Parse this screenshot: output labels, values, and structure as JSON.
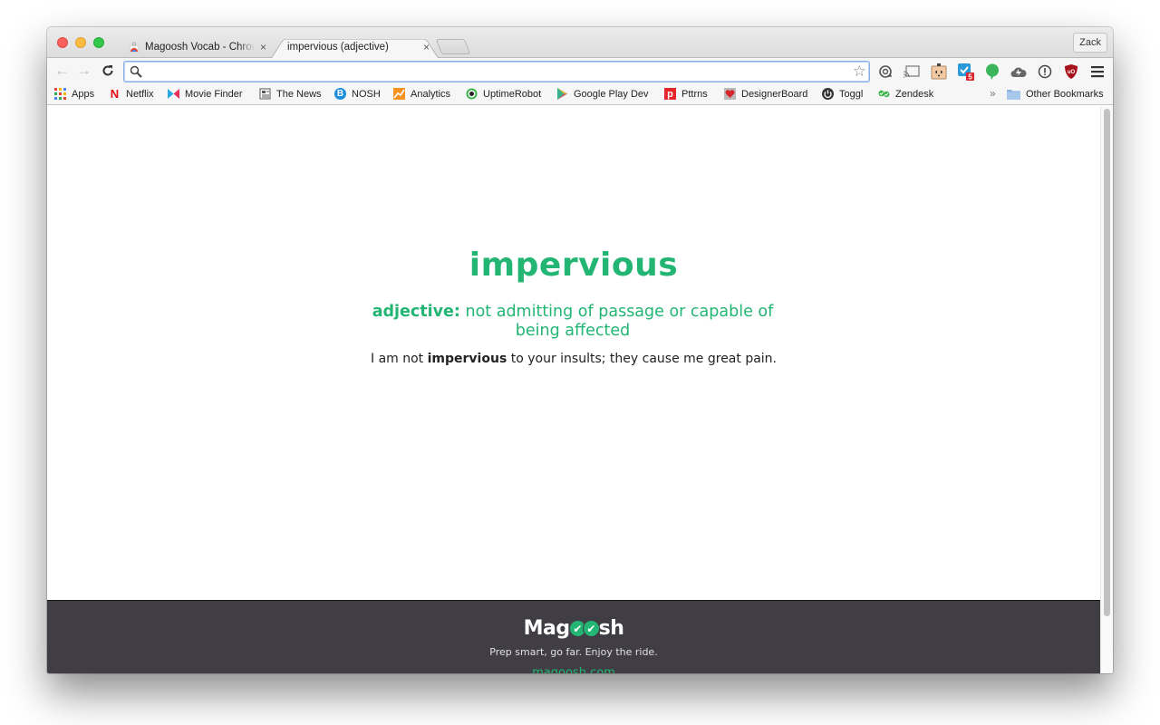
{
  "browser": {
    "tabs": [
      {
        "title": "Magoosh Vocab - Chrome Web Store",
        "active": false
      },
      {
        "title": "impervious (adjective)",
        "active": true
      }
    ],
    "close_glyph": "×",
    "profile_name": "Zack",
    "omnibox": {
      "value": "",
      "placeholder": ""
    },
    "nav": {
      "back": "←",
      "forward": "→",
      "reload": "C"
    },
    "extensions": [
      {
        "name": "sync-icon"
      },
      {
        "name": "cast-icon"
      },
      {
        "name": "outlet-icon"
      },
      {
        "name": "checkbox-extension-icon",
        "badge": "5"
      },
      {
        "name": "green-chat-bubble-icon"
      },
      {
        "name": "cloud-upload-icon"
      },
      {
        "name": "info-icon"
      },
      {
        "name": "ublock-icon"
      },
      {
        "name": "menu-icon"
      }
    ],
    "bookmarks": [
      {
        "label": "Apps",
        "icon": "apps-grid-icon"
      },
      {
        "label": "Netflix",
        "icon": "netflix-icon"
      },
      {
        "label": "Movie Finder",
        "icon": "movie-finder-icon"
      },
      {
        "label": "The News",
        "icon": "newspaper-icon"
      },
      {
        "label": "NOSH",
        "icon": "nosh-icon"
      },
      {
        "label": "Analytics",
        "icon": "analytics-icon"
      },
      {
        "label": "UptimeRobot",
        "icon": "uptimerobot-icon"
      },
      {
        "label": "Google Play Dev",
        "icon": "google-play-icon"
      },
      {
        "label": "Pttrns",
        "icon": "pttrns-icon"
      },
      {
        "label": "DesignerBoard",
        "icon": "designerboard-icon"
      },
      {
        "label": "Toggl",
        "icon": "toggl-icon"
      },
      {
        "label": "Zendesk",
        "icon": "zendesk-icon"
      }
    ],
    "bookmarks_overflow": "»",
    "other_bookmarks": "Other Bookmarks"
  },
  "page": {
    "word": "impervious",
    "part_of_speech": "adjective:",
    "definition": "not admitting of passage or capable of being affected",
    "example_before": "I am not ",
    "example_word": "impervious",
    "example_after": " to your insults; they cause me great pain.",
    "accent_color": "#22b573"
  },
  "footer": {
    "logo_prefix": "Mag",
    "logo_suffix": "sh",
    "tagline": "Prep smart, go far. Enjoy the ride.",
    "site": "magoosh.com",
    "background_color": "#403e44"
  }
}
